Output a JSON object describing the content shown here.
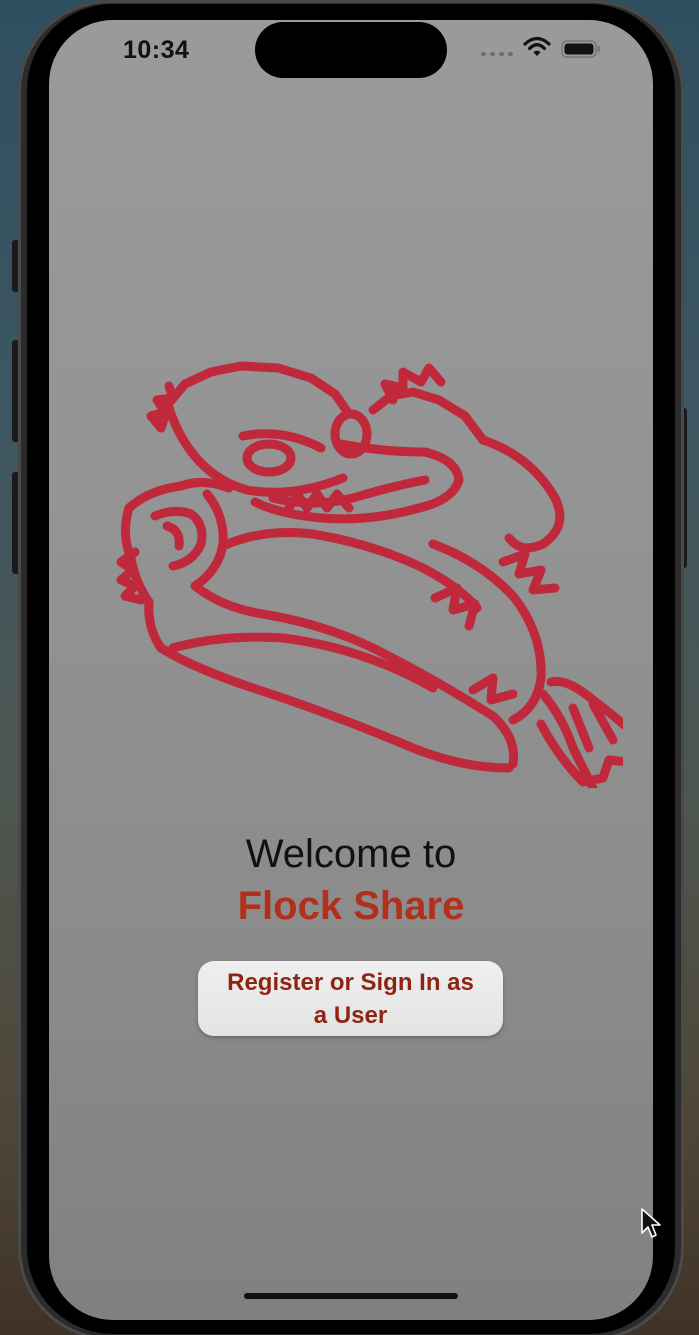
{
  "status_bar": {
    "time": "10:34",
    "icons": [
      "cellular-signal-icon",
      "wifi-icon",
      "battery-icon"
    ]
  },
  "mascot": {
    "icon": "duck-mascot-icon",
    "color": "#c0283b"
  },
  "welcome": {
    "line1": "Welcome to",
    "app_name": "Flock Share"
  },
  "actions": {
    "register_label": "Register or Sign In as a User"
  },
  "colors": {
    "accent": "#b0301c",
    "button_text": "#8e2512",
    "button_bg": "#e9e9e9",
    "screen_bg": "#939393"
  }
}
